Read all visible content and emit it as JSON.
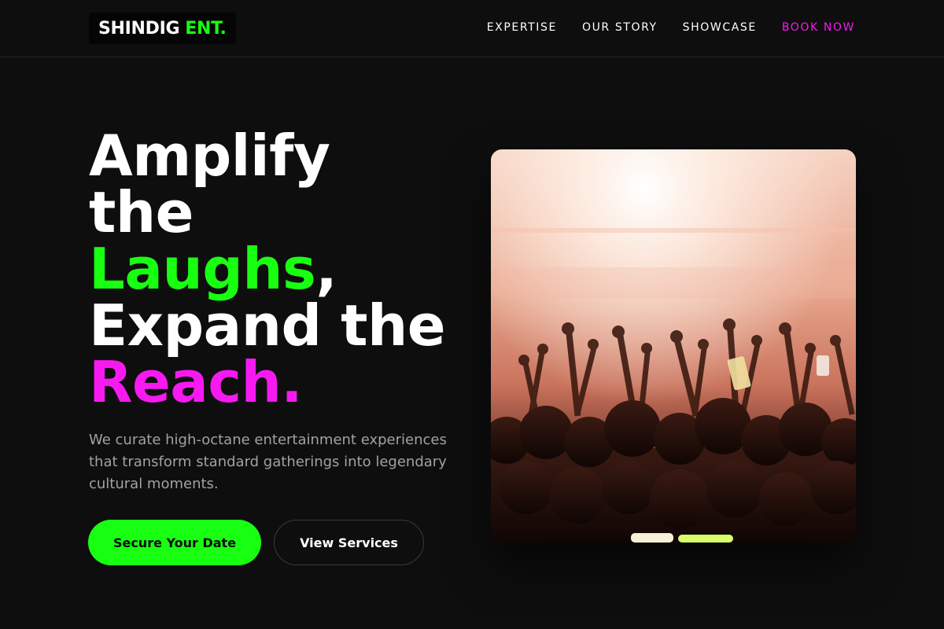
{
  "header": {
    "logo": {
      "primary": "SHINDIG",
      "accent": "ENT."
    },
    "nav": [
      {
        "label": "EXPERTISE"
      },
      {
        "label": "OUR STORY"
      },
      {
        "label": "SHOWCASE"
      },
      {
        "label": "BOOK NOW"
      }
    ]
  },
  "hero": {
    "title": {
      "line1": "Amplify",
      "line2": "the",
      "line3_accent": "Laughs",
      "line3_rest": ",",
      "line4": "Expand the",
      "line5_accent": "Reach."
    },
    "description": "We curate high-octane entertainment experiences that transform standard gatherings into legendary cultural moments.",
    "primary_button": "Secure Your Date",
    "secondary_button": "View Services",
    "image_alt": "Concert crowd with raised hands under bright stage lights"
  },
  "colors": {
    "background": "#0e0e0e",
    "accent_green": "#18ff12",
    "accent_magenta": "#f61af1",
    "muted_text": "#a2a2a6"
  }
}
